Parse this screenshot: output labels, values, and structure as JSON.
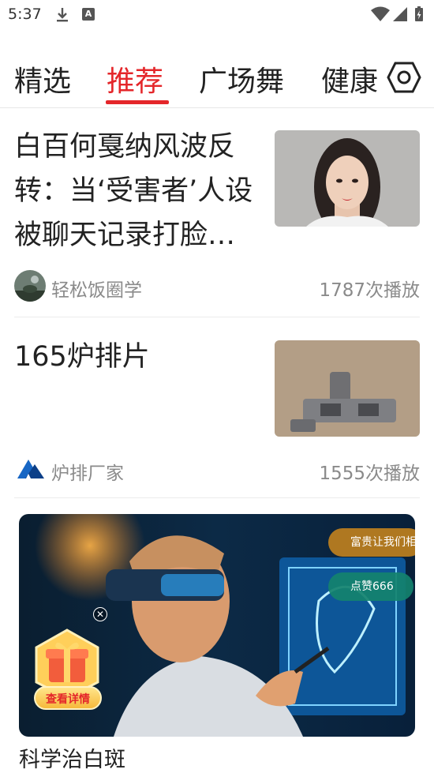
{
  "status_bar": {
    "time": "5:37",
    "a_icon": "A"
  },
  "tabs": {
    "items": [
      {
        "label": "精选"
      },
      {
        "label": "推荐"
      },
      {
        "label": "广场舞"
      },
      {
        "label": "健康"
      }
    ],
    "active_index": 1,
    "settings_icon": "settings-icon"
  },
  "articles": [
    {
      "title": "白百何戛纳风波反转：当‘受害者’人设被聊天记录打脸…",
      "author": "轻松饭圈学",
      "plays": "1787次播放"
    },
    {
      "title": "165炉排片",
      "author": "炉排厂家",
      "plays": "1555次播放"
    }
  ],
  "ad": {
    "pill1": "富贵让我们相",
    "pill2": "点赞666",
    "close": "✕",
    "gift_label": "查看详情",
    "title": "科学治白斑"
  },
  "colors": {
    "accent": "#e4262a",
    "meta_text": "#8a8a8a"
  }
}
